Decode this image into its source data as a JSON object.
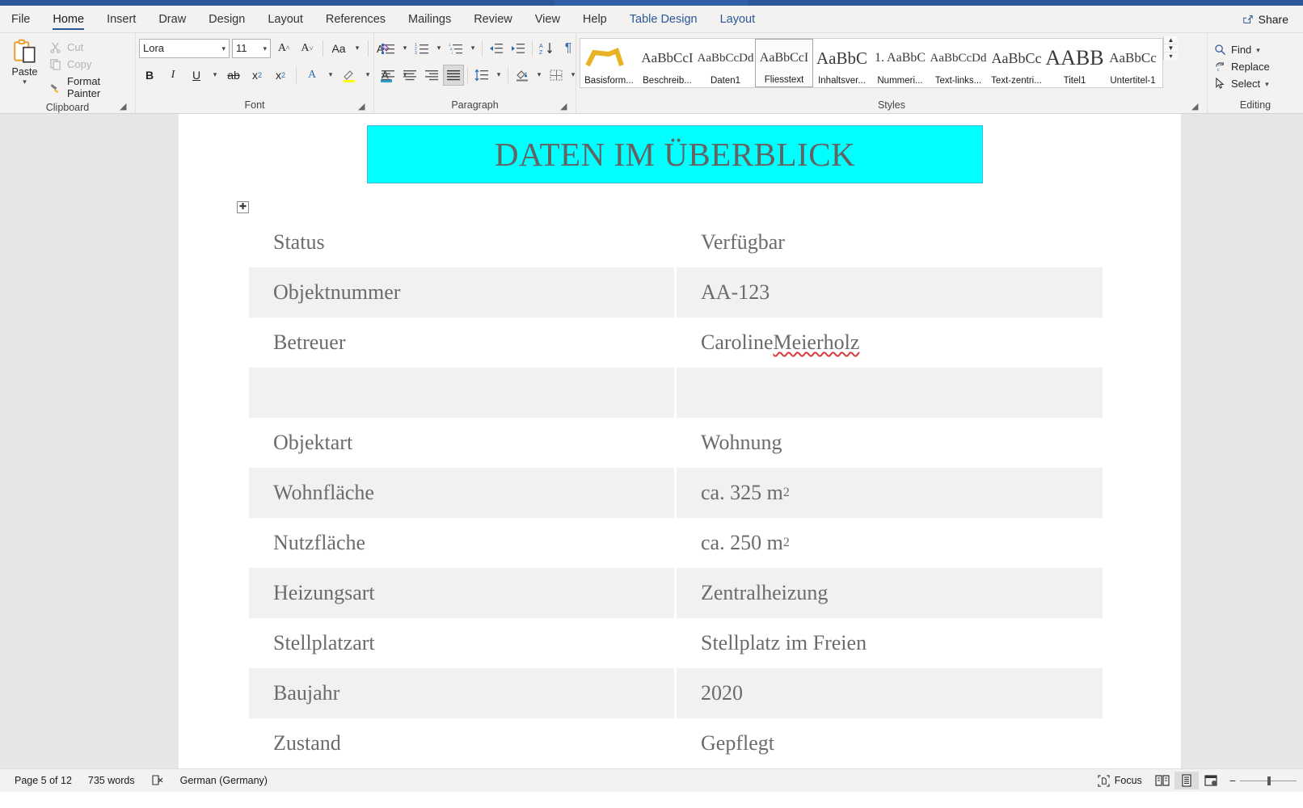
{
  "app": {
    "share_label": "Share",
    "share_icon": "share-icon"
  },
  "tabs": [
    {
      "label": "File",
      "state": "normal"
    },
    {
      "label": "Home",
      "state": "active"
    },
    {
      "label": "Insert",
      "state": "normal"
    },
    {
      "label": "Draw",
      "state": "normal"
    },
    {
      "label": "Design",
      "state": "normal"
    },
    {
      "label": "Layout",
      "state": "normal"
    },
    {
      "label": "References",
      "state": "normal"
    },
    {
      "label": "Mailings",
      "state": "normal"
    },
    {
      "label": "Review",
      "state": "normal"
    },
    {
      "label": "View",
      "state": "normal"
    },
    {
      "label": "Help",
      "state": "normal"
    },
    {
      "label": "Table Design",
      "state": "contextual"
    },
    {
      "label": "Layout",
      "state": "contextual"
    }
  ],
  "ribbon": {
    "clipboard": {
      "group_label": "Clipboard",
      "paste_label": "Paste",
      "cut_label": "Cut",
      "copy_label": "Copy",
      "format_painter_label": "Format Painter"
    },
    "font": {
      "group_label": "Font",
      "font_name": "Lora",
      "font_size": "11"
    },
    "paragraph": {
      "group_label": "Paragraph"
    },
    "styles": {
      "group_label": "Styles",
      "items": [
        {
          "preview": "⌒",
          "name": "Basisform...",
          "selected": false
        },
        {
          "preview": "AaBbCcI",
          "name": "Beschreib...",
          "selected": false
        },
        {
          "preview": "AaBbCcDd",
          "name": "Daten1",
          "selected": false
        },
        {
          "preview": "AaBbCcI",
          "name": "Fliesstext",
          "selected": true
        },
        {
          "preview": "AaBbC",
          "name": "Inhaltsver...",
          "selected": false
        },
        {
          "preview": "1. AaBbC",
          "name": "Nummeri...",
          "selected": false
        },
        {
          "preview": "AaBbCcDd",
          "name": "Text-links...",
          "selected": false
        },
        {
          "preview": "AaBbCc",
          "name": "Text-zentri...",
          "selected": false
        },
        {
          "preview": "AABB",
          "name": "Titel1",
          "selected": false
        },
        {
          "preview": "AaBbCc",
          "name": "Untertitel-1",
          "selected": false
        }
      ]
    },
    "editing": {
      "group_label": "Editing",
      "find_label": "Find",
      "replace_label": "Replace",
      "select_label": "Select"
    }
  },
  "document": {
    "title_banner": "DATEN IM ÜBERBLICK",
    "table": {
      "rows": [
        {
          "label": "Status",
          "value": "Verfügbar",
          "shaded": false,
          "sup": "",
          "misspelled": ""
        },
        {
          "label": "Objektnummer",
          "value": "AA-123",
          "shaded": true,
          "sup": "",
          "misspelled": ""
        },
        {
          "label": "Betreuer",
          "value": "Caroline Meierholz",
          "shaded": false,
          "sup": "",
          "misspelled": "Meierholz"
        },
        {
          "label": "",
          "value": "",
          "shaded": true,
          "sup": "",
          "misspelled": ""
        },
        {
          "label": "Objektart",
          "value": "Wohnung",
          "shaded": false,
          "sup": "",
          "misspelled": ""
        },
        {
          "label": "Wohnfläche",
          "value": "ca. 325 m",
          "shaded": true,
          "sup": "2",
          "misspelled": ""
        },
        {
          "label": "Nutzfläche",
          "value": "ca. 250 m",
          "shaded": false,
          "sup": "2",
          "misspelled": ""
        },
        {
          "label": "Heizungsart",
          "value": "Zentralheizung",
          "shaded": true,
          "sup": "",
          "misspelled": ""
        },
        {
          "label": "Stellplatzart",
          "value": "Stellplatz im Freien",
          "shaded": false,
          "sup": "",
          "misspelled": ""
        },
        {
          "label": "Baujahr",
          "value": "2020",
          "shaded": true,
          "sup": "",
          "misspelled": ""
        },
        {
          "label": "Zustand",
          "value": "Gepflegt",
          "shaded": false,
          "sup": "",
          "misspelled": ""
        }
      ]
    }
  },
  "statusbar": {
    "page_info": "Page 5 of 12",
    "word_count": "735 words",
    "proofing_icon": "proofing-errors-icon",
    "language": "German (Germany)",
    "focus_label": "Focus",
    "view_read": "read-mode-icon",
    "view_print": "print-layout-icon",
    "view_web": "web-layout-icon"
  }
}
